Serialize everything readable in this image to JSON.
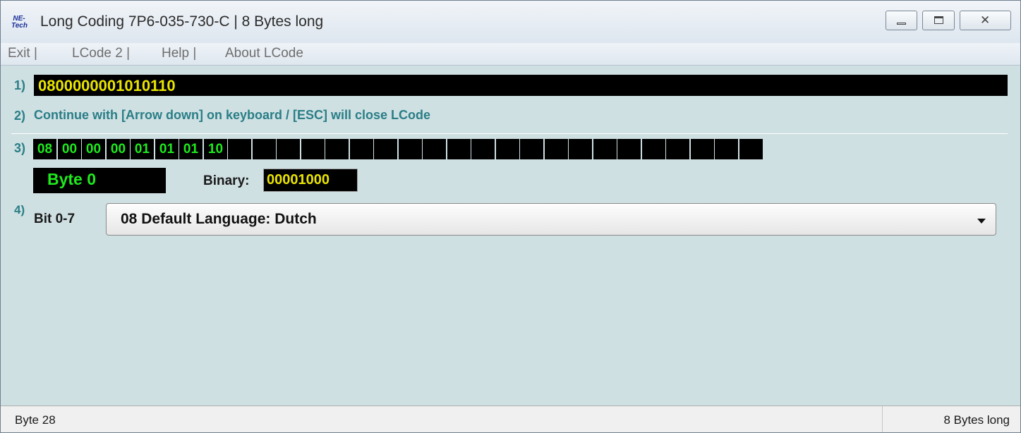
{
  "window": {
    "icon": {
      "name": "ne-tech-logo",
      "text_top": "NE-",
      "text_bottom": "Tech"
    },
    "title": "Long Coding  7P6-035-730-C | 8 Bytes long"
  },
  "menu": [
    {
      "label": "Exit |"
    },
    {
      "label": "LCode 2 |"
    },
    {
      "label": "Help |"
    },
    {
      "label": "About LCode"
    }
  ],
  "steps": {
    "step1": "1)",
    "step2": "2)",
    "step3": "3)",
    "step4": "4)"
  },
  "coding_string": "0800000001010110",
  "instruction": "Continue with [Arrow down] on keyboard / [ESC] will close LCode",
  "bytes": [
    "08",
    "00",
    "00",
    "00",
    "01",
    "01",
    "01",
    "10",
    "",
    "",
    "",
    "",
    "",
    "",
    "",
    "",
    "",
    "",
    "",
    "",
    "",
    "",
    "",
    "",
    "",
    "",
    "",
    "",
    "",
    ""
  ],
  "selected_byte": {
    "label": "Byte 0",
    "binary_label": "Binary:",
    "binary_value": "00001000"
  },
  "bit_label": "Bit 0-7",
  "dropdown": {
    "selected": "08 Default Language: Dutch"
  },
  "status": {
    "left": "Byte 28",
    "right": "8 Bytes long"
  },
  "colors": {
    "background": "#cfe0e3",
    "accent_text": "#2a7e86",
    "byte_green": "#1eea1e",
    "value_yellow": "#e9e400"
  }
}
